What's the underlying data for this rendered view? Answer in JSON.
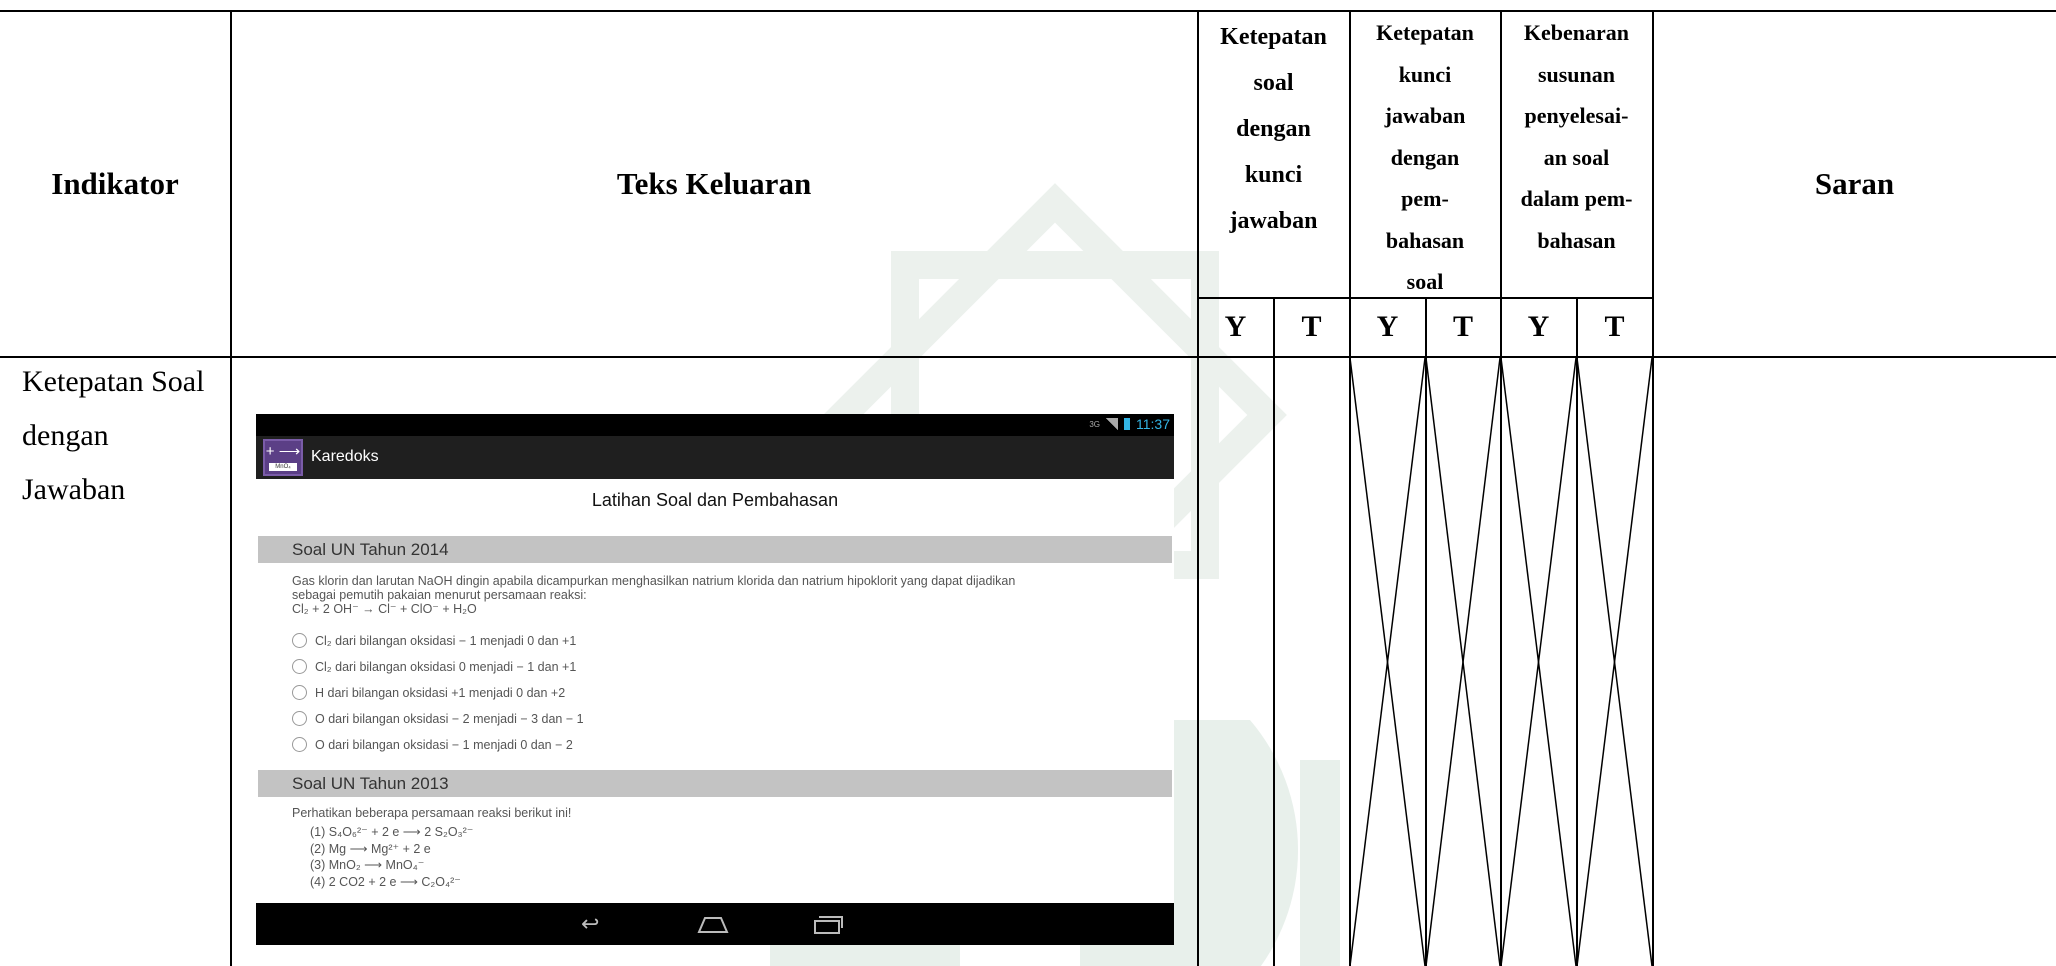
{
  "table": {
    "headers": {
      "indikator": "Indikator",
      "teks_keluaran": "Teks Keluaran",
      "criterion_1": [
        "Ketepatan",
        "soal",
        "dengan",
        "kunci",
        "jawaban"
      ],
      "criterion_2": [
        "Ketepatan",
        "kunci",
        "jawaban",
        "dengan",
        "pem-",
        "bahasan",
        "soal"
      ],
      "criterion_3": [
        "Kebenaran",
        "susunan",
        "penyelesai-",
        "an soal",
        "dalam pem-",
        "bahasan"
      ],
      "saran": "Saran",
      "y_label": "Y",
      "t_label": "T"
    },
    "row": {
      "indikator_lines": [
        "Ketepatan Soal",
        "dengan",
        "Jawaban"
      ]
    }
  },
  "screenshot": {
    "status_time": "11:37",
    "status_network": "3G",
    "app_icon_symbol": "+ ⟶",
    "app_icon_caption": "MnO₄",
    "app_name": "Karedoks",
    "screen_title": "Latihan Soal dan Pembahasan",
    "section_1": {
      "title": "Soal UN Tahun 2014",
      "question_lines": [
        "Gas klorin dan larutan NaOH dingin apabila dicampurkan menghasilkan natrium klorida dan natrium hipoklorit yang dapat dijadikan",
        "sebagai pemutih pakaian menurut persamaan reaksi:",
        "Cl₂ + 2 OH⁻ → Cl⁻ + ClO⁻ + H₂O"
      ],
      "options": [
        "Cl₂ dari bilangan oksidasi − 1 menjadi 0 dan +1",
        "Cl₂ dari bilangan oksidasi 0 menjadi − 1 dan +1",
        "H dari bilangan oksidasi +1 menjadi 0 dan +2",
        "O dari bilangan oksidasi − 2 menjadi − 3 dan − 1",
        "O dari bilangan oksidasi − 1 menjadi 0 dan − 2"
      ]
    },
    "section_2": {
      "title": "Soal UN Tahun 2013",
      "question": "Perhatikan beberapa persamaan reaksi berikut ini!",
      "items": [
        "(1)   S₄O₆²⁻ + 2 e ⟶ 2 S₂O₃²⁻",
        "(2)   Mg ⟶ Mg²⁺ + 2 e",
        "(3)   MnO₂ ⟶ MnO₄⁻",
        "(4)   2 CO2 + 2 e ⟶ C₂O₄²⁻"
      ]
    },
    "nav_icons": [
      "back-icon",
      "home-icon",
      "recent-apps-icon"
    ]
  },
  "colors": {
    "watermark": "#e3ebe7",
    "status_accent": "#33b5e5",
    "section_bar": "#c3c3c3",
    "action_bar": "#1f1f1f"
  }
}
